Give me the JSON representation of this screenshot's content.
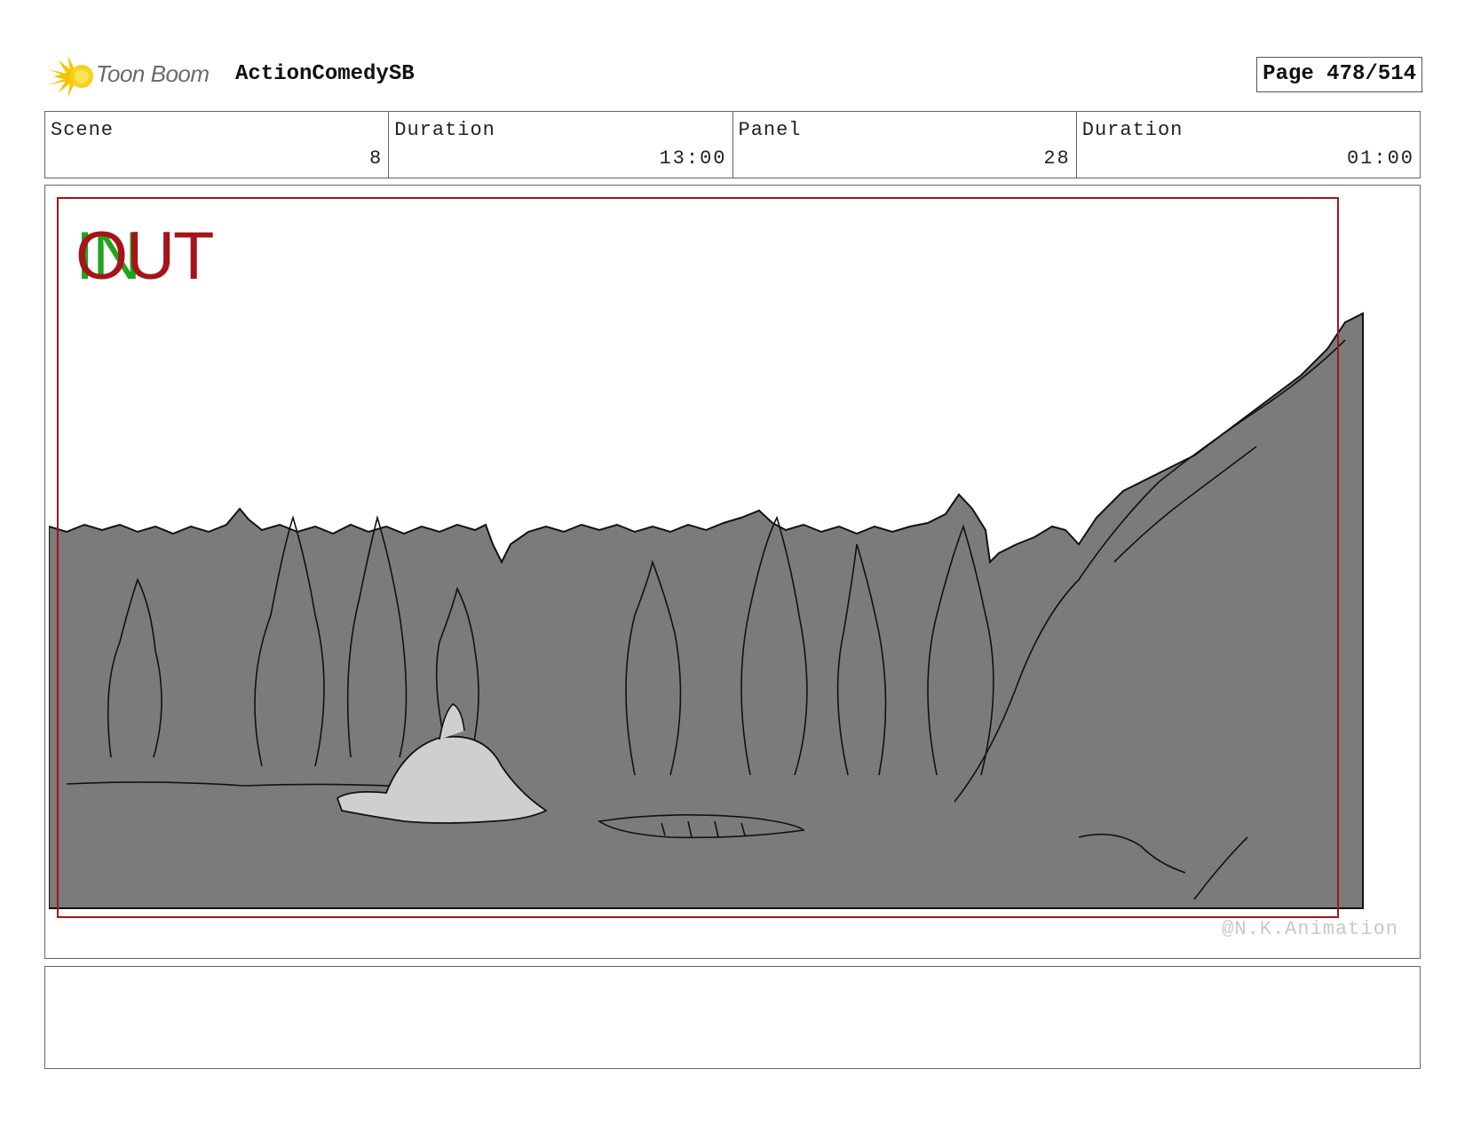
{
  "header": {
    "logo_text": "Toon Boom",
    "project_title": "ActionComedySB",
    "page_label": "Page 478/514"
  },
  "info": {
    "scene_label": "Scene",
    "scene_value": "8",
    "scene_duration_label": "Duration",
    "scene_duration_value": "13:00",
    "panel_label": "Panel",
    "panel_value": "28",
    "panel_duration_label": "Duration",
    "panel_duration_value": "01:00"
  },
  "panel": {
    "in_label": "IN",
    "out_label": "OUT",
    "watermark": "@N.K.Animation"
  },
  "notes": {
    "text": ""
  },
  "colors": {
    "in_green": "#1fa51f",
    "out_red": "#a5141a",
    "ground_gray": "#7b7b7b",
    "logo_yellow": "#f5c400"
  }
}
